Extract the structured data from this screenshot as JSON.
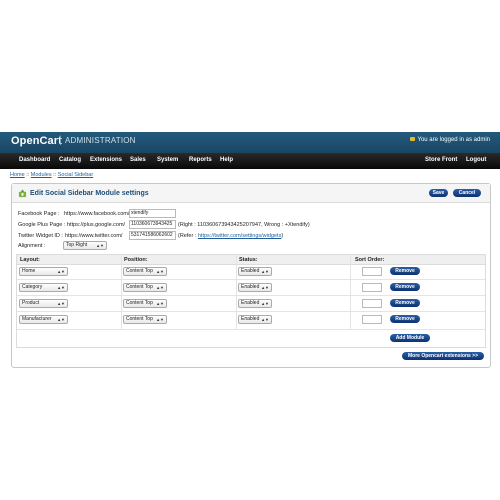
{
  "header": {
    "logo": "OpenCart",
    "separator": "|",
    "subtitle": "ADMINISTRATION",
    "login_text": "You are logged in as admin"
  },
  "menu": {
    "left": [
      "Dashboard",
      "Catalog",
      "Extensions",
      "Sales",
      "System",
      "Reports",
      "Help"
    ],
    "right": [
      "Store Front",
      "Logout"
    ]
  },
  "breadcrumb": {
    "home": "Home",
    "sep1": " :: ",
    "modules": "Modules",
    "sep2": " :: ",
    "current": "Social Sidebar"
  },
  "box": {
    "title": "Edit Social Sidebar Module settings",
    "save_label": "Save",
    "cancel_label": "Cancel"
  },
  "form": {
    "facebook_label": "Facebook Page :",
    "facebook_prefix": "https://www.facebook.com/",
    "facebook_value": "xtendify",
    "gplus_label": "Google Plus Page :",
    "gplus_prefix": "https://plus.google.com/",
    "gplus_value": "110360673943425",
    "gplus_hint": "(Right : 110360673943425207947, Wrong : +Xtendify)",
    "twitter_label": "Twitter Widget ID :",
    "twitter_prefix": "https://www.twitter.com/",
    "twitter_value": "531741586062602",
    "twitter_hint_open": "(Refer : ",
    "twitter_hint_link": "https://twitter.com/settings/widgets",
    "twitter_hint_close": ")",
    "alignment_label": "Alignment :",
    "alignment_value": "Top Right"
  },
  "table": {
    "headers": [
      "Layout:",
      "Position:",
      "Status:",
      "Sort Order:"
    ],
    "rows": [
      {
        "layout": "Home",
        "position": "Content Top",
        "status": "Enabled",
        "sort": "",
        "remove": "Remove"
      },
      {
        "layout": "Category",
        "position": "Content Top",
        "status": "Enabled",
        "sort": "",
        "remove": "Remove"
      },
      {
        "layout": "Product",
        "position": "Content Top",
        "status": "Enabled",
        "sort": "",
        "remove": "Remove"
      },
      {
        "layout": "Manufacturer",
        "position": "Content Top",
        "status": "Enabled",
        "sort": "",
        "remove": "Remove"
      }
    ],
    "add_module_label": "Add Module"
  },
  "more_extensions_label": "More Opencart extensions >>",
  "colors": {
    "header": "#1d4f6d",
    "menu": "#111111",
    "button": "#0f3d7d",
    "title": "#1e4f78"
  }
}
